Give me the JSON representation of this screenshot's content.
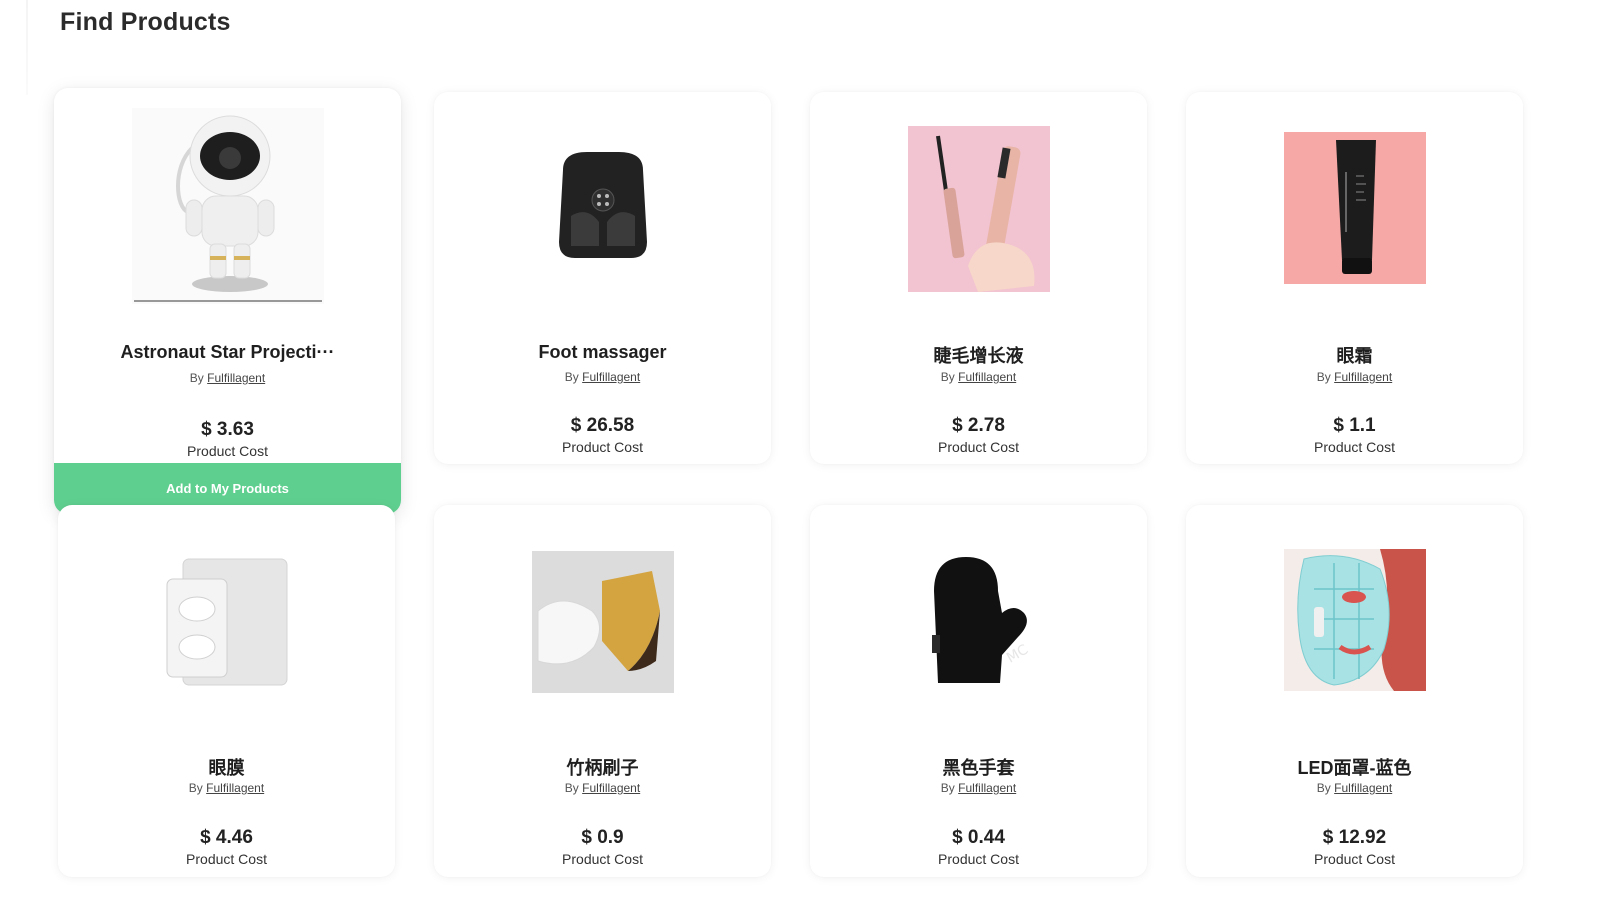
{
  "page": {
    "title": "Find Products"
  },
  "labels": {
    "by": "By",
    "cost": "Product Cost",
    "add": "Add to My Products"
  },
  "products": [
    {
      "name": "Astronaut Star Projecti···",
      "supplier": "Fulfillagent",
      "price": "$ 3.63",
      "icon": "astronaut-projector"
    },
    {
      "name": "Foot massager",
      "supplier": "Fulfillagent",
      "price": "$ 26.58",
      "icon": "foot-massager"
    },
    {
      "name": "睫毛增长液",
      "supplier": "Fulfillagent",
      "price": "$ 2.78",
      "icon": "eyelash-serum"
    },
    {
      "name": "眼霜",
      "supplier": "Fulfillagent",
      "price": "$ 1.1",
      "icon": "eye-cream-tube"
    },
    {
      "name": "眼膜",
      "supplier": "Fulfillagent",
      "price": "$ 4.46",
      "icon": "eye-mask-pack"
    },
    {
      "name": "竹柄刷子",
      "supplier": "Fulfillagent",
      "price": "$ 0.9",
      "icon": "bamboo-brush"
    },
    {
      "name": "黑色手套",
      "supplier": "Fulfillagent",
      "price": "$ 0.44",
      "icon": "black-mitt"
    },
    {
      "name": "LED面罩-蓝色",
      "supplier": "Fulfillagent",
      "price": "$ 12.92",
      "icon": "led-face-mask"
    }
  ],
  "colors": {
    "accent": "#5fcf8f"
  }
}
